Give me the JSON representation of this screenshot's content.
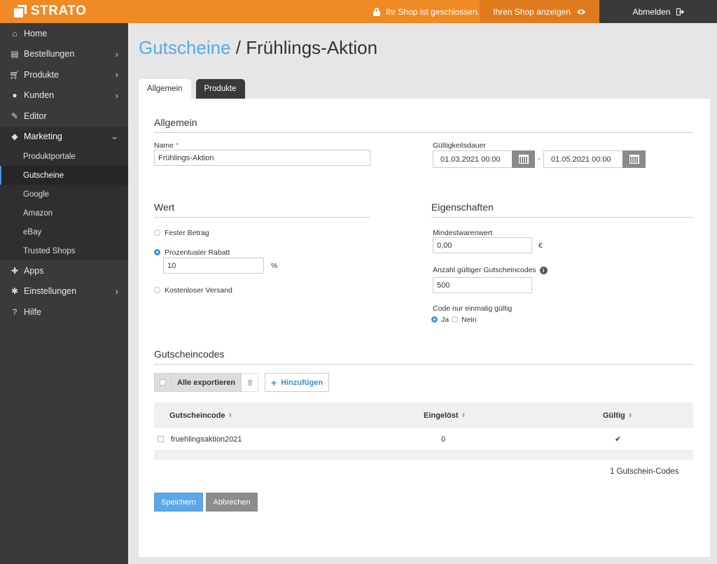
{
  "topbar": {
    "logo": "STRATO",
    "shop_status": "Ihr Shop ist geschlossen.",
    "show_shop": "Ihren Shop anzeigen",
    "logout": "Abmelden"
  },
  "sidebar": {
    "items": [
      {
        "label": "Home",
        "icon": "home-icon"
      },
      {
        "label": "Bestellungen",
        "icon": "orders-icon"
      },
      {
        "label": "Produkte",
        "icon": "cart-icon"
      },
      {
        "label": "Kunden",
        "icon": "users-icon"
      },
      {
        "label": "Editor",
        "icon": "pencil-icon"
      },
      {
        "label": "Marketing",
        "icon": "tag-icon"
      }
    ],
    "marketing_sub": [
      "Produktportale",
      "Gutscheine",
      "Google",
      "Amazon",
      "eBay",
      "Trusted Shops"
    ],
    "bottom_items": [
      {
        "label": "Apps",
        "icon": "puzzle-icon"
      },
      {
        "label": "Einstellungen",
        "icon": "gear-icon"
      },
      {
        "label": "Hilfe",
        "icon": "question-icon"
      }
    ]
  },
  "page": {
    "crumb": "Gutscheine",
    "separator": "/",
    "title": "Frühlings-Aktion"
  },
  "tabs": [
    "Allgemein",
    "Produkte"
  ],
  "general": {
    "section": "Allgemein",
    "name_label": "Name",
    "name_required": "*",
    "name_value": "Frühlings-Aktion",
    "validity_label": "Gültigkeitsdauer",
    "date_from": "01.03.2021 00:00",
    "date_sep": "-",
    "date_to": "01.05.2021 00:00"
  },
  "value": {
    "section": "Wert",
    "options": [
      "Fester Betrag",
      "Prozentualer Rabatt",
      "Kostenloser Versand"
    ],
    "selected": "Prozentualer Rabatt",
    "percent_value": "10",
    "percent_unit": "%"
  },
  "properties": {
    "section": "Eigenschaften",
    "min_value_label": "Mindestwarenwert",
    "min_value": "0,00",
    "currency": "€",
    "codes_count_label": "Anzahl gültiger Gutscheincodes",
    "codes_count": "500",
    "once_label": "Code nur einmalig gültig",
    "once_yes": "Ja",
    "once_no": "Nein",
    "once_selected": "Ja"
  },
  "codes": {
    "section": "Gutscheincodes",
    "export_label": "Alle exportieren",
    "add_label": "Hinzufügen",
    "columns": [
      "Gutscheincode",
      "Eingelöst",
      "Gültig"
    ],
    "rows": [
      {
        "code": "fruehlingsaktion2021",
        "redeemed": "0",
        "valid": "✔"
      }
    ],
    "count_text": "1 Gutschein-Codes"
  },
  "actions": {
    "save": "Speichern",
    "cancel": "Abbrechen"
  },
  "colors": {
    "brand": "#f08a24",
    "sidebar": "#3a3a3a",
    "accent": "#3b8fd9"
  }
}
